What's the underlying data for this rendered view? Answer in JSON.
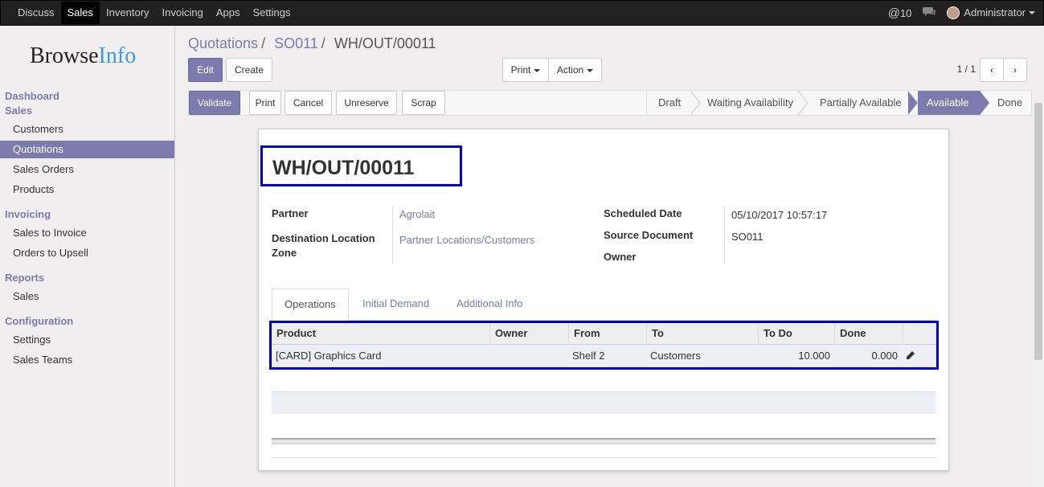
{
  "topbar": {
    "menu": [
      "Discuss",
      "Sales",
      "Inventory",
      "Invoicing",
      "Apps",
      "Settings"
    ],
    "active": "Sales",
    "mentions": "10",
    "user": "Administrator"
  },
  "logo": {
    "part1": "Browse",
    "part2": "Info"
  },
  "sidebar": {
    "sections": [
      {
        "title": "Dashboard"
      },
      {
        "title": "Sales",
        "items": [
          "Customers",
          "Quotations",
          "Sales Orders",
          "Products"
        ]
      },
      {
        "title": "Invoicing",
        "items": [
          "Sales to Invoice",
          "Orders to Upsell"
        ]
      },
      {
        "title": "Reports",
        "items": [
          "Sales"
        ]
      },
      {
        "title": "Configuration",
        "items": [
          "Settings",
          "Sales Teams"
        ]
      }
    ],
    "active_item": "Quotations"
  },
  "breadcrumb": {
    "items": [
      "Quotations",
      "SO011"
    ],
    "current": "WH/OUT/00011"
  },
  "buttons": {
    "edit": "Edit",
    "create": "Create",
    "print": "Print",
    "action": "Action",
    "validate": "Validate",
    "print2": "Print",
    "cancel": "Cancel",
    "unreserve": "Unreserve",
    "scrap": "Scrap"
  },
  "pager": "1 / 1",
  "stages": [
    "Draft",
    "Waiting Availability",
    "Partially Available",
    "Available",
    "Done"
  ],
  "active_stage": "Available",
  "record": {
    "name": "WH/OUT/00011",
    "partner_label": "Partner",
    "partner": "Agrolait",
    "dest_label_1": "Destination Location",
    "dest_label_2": "Zone",
    "dest": "Partner Locations/Customers",
    "sched_label": "Scheduled Date",
    "sched": "05/10/2017 10:57:17",
    "source_label": "Source Document",
    "source": "SO011",
    "owner_label": "Owner"
  },
  "tabs": [
    "Operations",
    "Initial Demand",
    "Additional Info"
  ],
  "table": {
    "headers": [
      "Product",
      "Owner",
      "From",
      "To",
      "To Do",
      "Done"
    ],
    "rows": [
      {
        "product": "[CARD] Graphics Card",
        "owner": "",
        "from": "Shelf 2",
        "to": "Customers",
        "todo": "10.000",
        "done": "0.000"
      }
    ]
  },
  "colors": {
    "accent": "#7c7bad",
    "highlight_box": "#0000cc",
    "topbar": "#212121"
  }
}
